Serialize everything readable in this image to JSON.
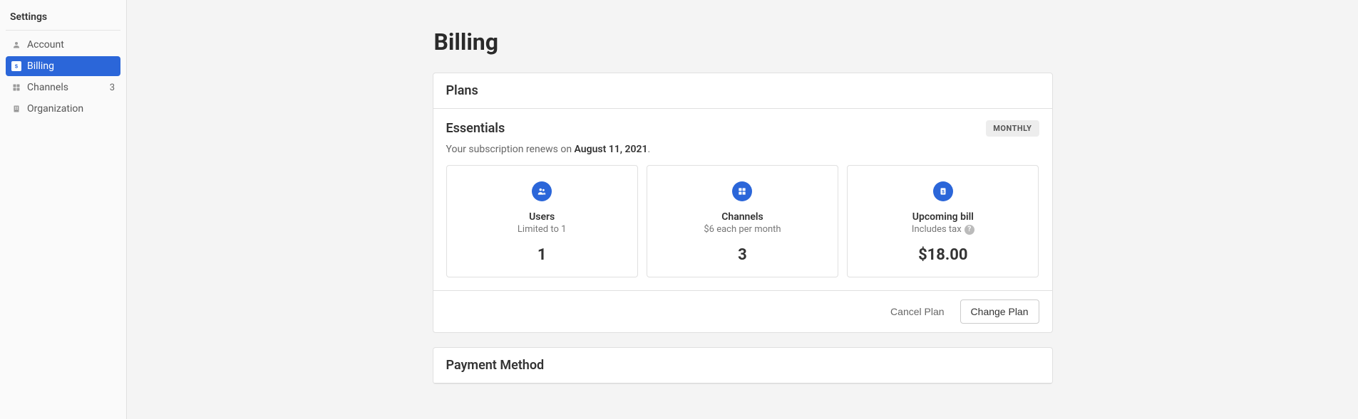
{
  "sidebar": {
    "title": "Settings",
    "items": [
      {
        "label": "Account"
      },
      {
        "label": "Billing"
      },
      {
        "label": "Channels",
        "badge": "3"
      },
      {
        "label": "Organization"
      }
    ]
  },
  "page": {
    "title": "Billing"
  },
  "plans": {
    "header": "Plans",
    "name": "Essentials",
    "period": "MONTHLY",
    "renew_prefix": "Your subscription renews on ",
    "renew_date": "August 11, 2021",
    "renew_suffix": ".",
    "stats": {
      "users": {
        "title": "Users",
        "sub": "Limited to 1",
        "value": "1"
      },
      "channels": {
        "title": "Channels",
        "sub": "$6 each per month",
        "value": "3"
      },
      "bill": {
        "title": "Upcoming bill",
        "sub": "Includes tax",
        "value": "$18.00"
      }
    },
    "actions": {
      "cancel": "Cancel Plan",
      "change": "Change Plan"
    }
  },
  "payment": {
    "header": "Payment Method"
  }
}
